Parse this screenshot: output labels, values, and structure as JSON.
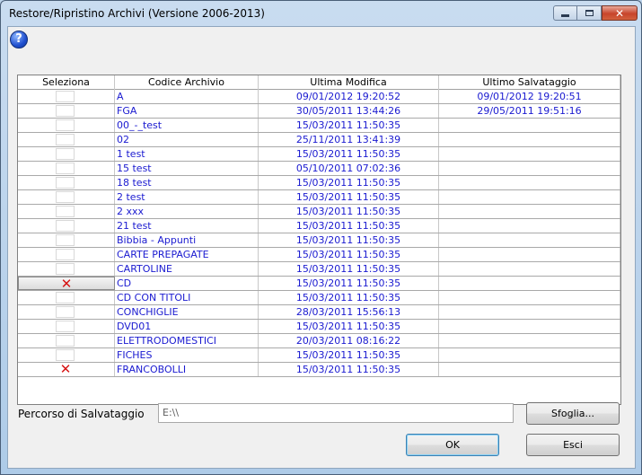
{
  "window": {
    "title": "Restore/Ripristino Archivi (Versione 2006-2013)",
    "close_glyph": "✕"
  },
  "help": {
    "glyph": "?",
    "icon": "help-icon"
  },
  "table": {
    "headers": {
      "select": "Seleziona",
      "code": "Codice Archivio",
      "modified": "Ultima Modifica",
      "saved": "Ultimo Salvataggio"
    },
    "rows": [
      {
        "selected": false,
        "code": "A",
        "modified": "09/01/2012 19:20:52",
        "saved": "09/01/2012 19:20:51"
      },
      {
        "selected": false,
        "code": "FGA",
        "modified": "30/05/2011 13:44:26",
        "saved": "29/05/2011 19:51:16"
      },
      {
        "selected": false,
        "code": "00_-_test",
        "modified": "15/03/2011 11:50:35",
        "saved": ""
      },
      {
        "selected": false,
        "code": "02",
        "modified": "25/11/2011 13:41:39",
        "saved": ""
      },
      {
        "selected": false,
        "code": "1 test",
        "modified": "15/03/2011 11:50:35",
        "saved": ""
      },
      {
        "selected": false,
        "code": "15 test",
        "modified": "05/10/2011 07:02:36",
        "saved": ""
      },
      {
        "selected": false,
        "code": "18 test",
        "modified": "15/03/2011 11:50:35",
        "saved": ""
      },
      {
        "selected": false,
        "code": "2 test",
        "modified": "15/03/2011 11:50:35",
        "saved": ""
      },
      {
        "selected": false,
        "code": "2 xxx",
        "modified": "15/03/2011 11:50:35",
        "saved": ""
      },
      {
        "selected": false,
        "code": "21 test",
        "modified": "15/03/2011 11:50:35",
        "saved": ""
      },
      {
        "selected": false,
        "code": "Bibbia - Appunti",
        "modified": "15/03/2011 11:50:35",
        "saved": ""
      },
      {
        "selected": false,
        "code": "CARTE PREPAGATE",
        "modified": "15/03/2011 11:50:35",
        "saved": ""
      },
      {
        "selected": false,
        "code": "CARTOLINE",
        "modified": "15/03/2011 11:50:35",
        "saved": ""
      },
      {
        "selected": true,
        "focused": true,
        "code": "CD",
        "modified": "15/03/2011 11:50:35",
        "saved": ""
      },
      {
        "selected": false,
        "code": "CD CON TITOLI",
        "modified": "15/03/2011 11:50:35",
        "saved": ""
      },
      {
        "selected": false,
        "code": "CONCHIGLIE",
        "modified": "28/03/2011 15:56:13",
        "saved": ""
      },
      {
        "selected": false,
        "code": "DVD01",
        "modified": "15/03/2011 11:50:35",
        "saved": ""
      },
      {
        "selected": false,
        "code": "ELETTRODOMESTICI",
        "modified": "20/03/2011 08:16:22",
        "saved": ""
      },
      {
        "selected": false,
        "code": "FICHES",
        "modified": "15/03/2011 11:50:35",
        "saved": ""
      },
      {
        "selected": true,
        "code": "FRANCOBOLLI",
        "modified": "15/03/2011 11:50:35",
        "saved": ""
      }
    ],
    "mark_glyph": "✕",
    "mark_color": "#d61414",
    "text_color": "#1a1ad0"
  },
  "path": {
    "label": "Percorso di Salvataggio",
    "value": "E:\\\\"
  },
  "buttons": {
    "browse": "Sfoglia...",
    "ok": "OK",
    "cancel": "Esci"
  }
}
